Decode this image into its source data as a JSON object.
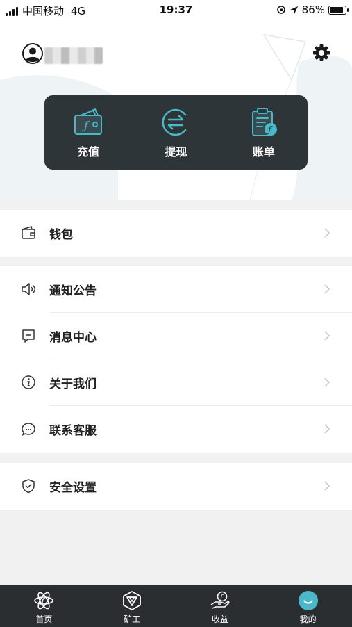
{
  "status": {
    "carrier": "中国移动",
    "network": "4G",
    "time": "19:37",
    "battery": "86%",
    "battery_level": 0.86
  },
  "header": {
    "actions": [
      {
        "label": "充值",
        "icon": "wallet-recharge-icon"
      },
      {
        "label": "提现",
        "icon": "withdraw-arrows-icon"
      },
      {
        "label": "账单",
        "icon": "bill-clipboard-icon"
      }
    ]
  },
  "menu": {
    "wallet": "钱包",
    "notice": "通知公告",
    "messages": "消息中心",
    "about": "关于我们",
    "support": "联系客服",
    "security": "安全设置"
  },
  "tabs": [
    {
      "label": "首页",
      "icon": "home-atom-icon",
      "active": false
    },
    {
      "label": "矿工",
      "icon": "miner-hex-icon",
      "active": false
    },
    {
      "label": "收益",
      "icon": "income-hand-icon",
      "active": false
    },
    {
      "label": "我的",
      "icon": "profile-smile-icon",
      "active": true
    }
  ],
  "colors": {
    "accent": "#4ab8c8",
    "card": "#2e3538",
    "tabbar": "#2a2e30"
  }
}
